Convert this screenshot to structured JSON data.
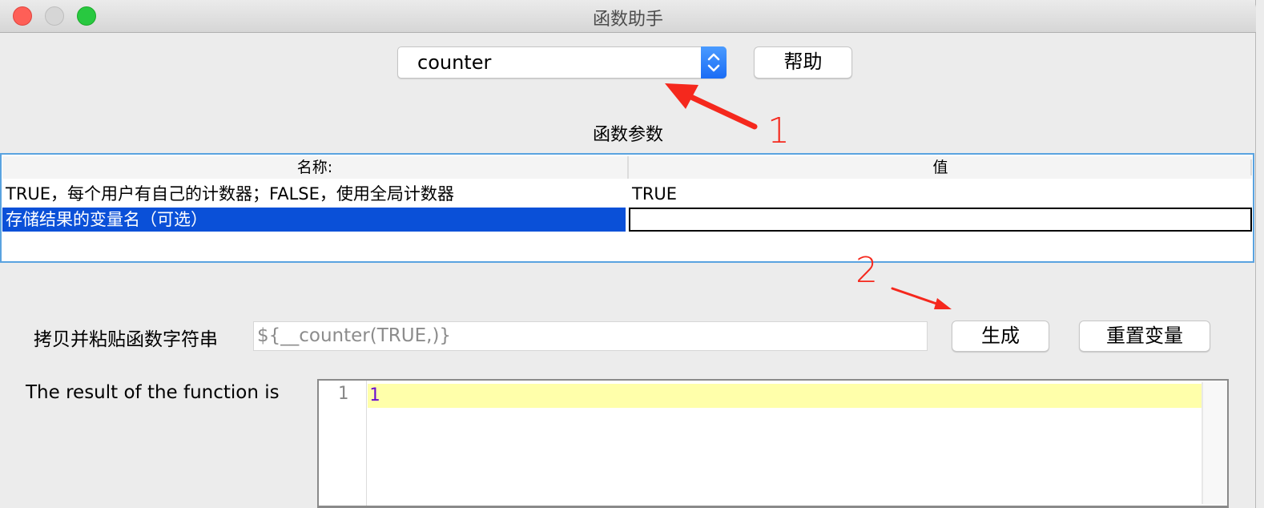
{
  "window": {
    "title": "函数助手",
    "controls": [
      "close",
      "minimize",
      "maximize"
    ]
  },
  "function_select": {
    "value": "counter",
    "help_label": "帮助"
  },
  "params_section": {
    "title": "函数参数",
    "columns": [
      "名称:",
      "值"
    ],
    "rows": [
      {
        "name": "TRUE，每个用户有自己的计数器；FALSE，使用全局计数器",
        "value": "TRUE",
        "selected": false
      },
      {
        "name": "存储结果的变量名（可选）",
        "value": "",
        "selected": true
      }
    ]
  },
  "function_string": {
    "label": "拷贝并粘贴函数字符串",
    "value": "${__counter(TRUE,)}",
    "generate_label": "生成",
    "reset_label": "重置变量"
  },
  "result": {
    "label": "The result of the function is",
    "lines": [
      {
        "number": "1",
        "text": "1"
      }
    ]
  },
  "annotations": {
    "step1": "1",
    "step2": "2",
    "color": "#f5281d"
  },
  "colors": {
    "selection": "#0a50d8",
    "table_border": "#5aa3e0",
    "current_line": "#ffffaa",
    "result_text": "#6a0dd0"
  }
}
